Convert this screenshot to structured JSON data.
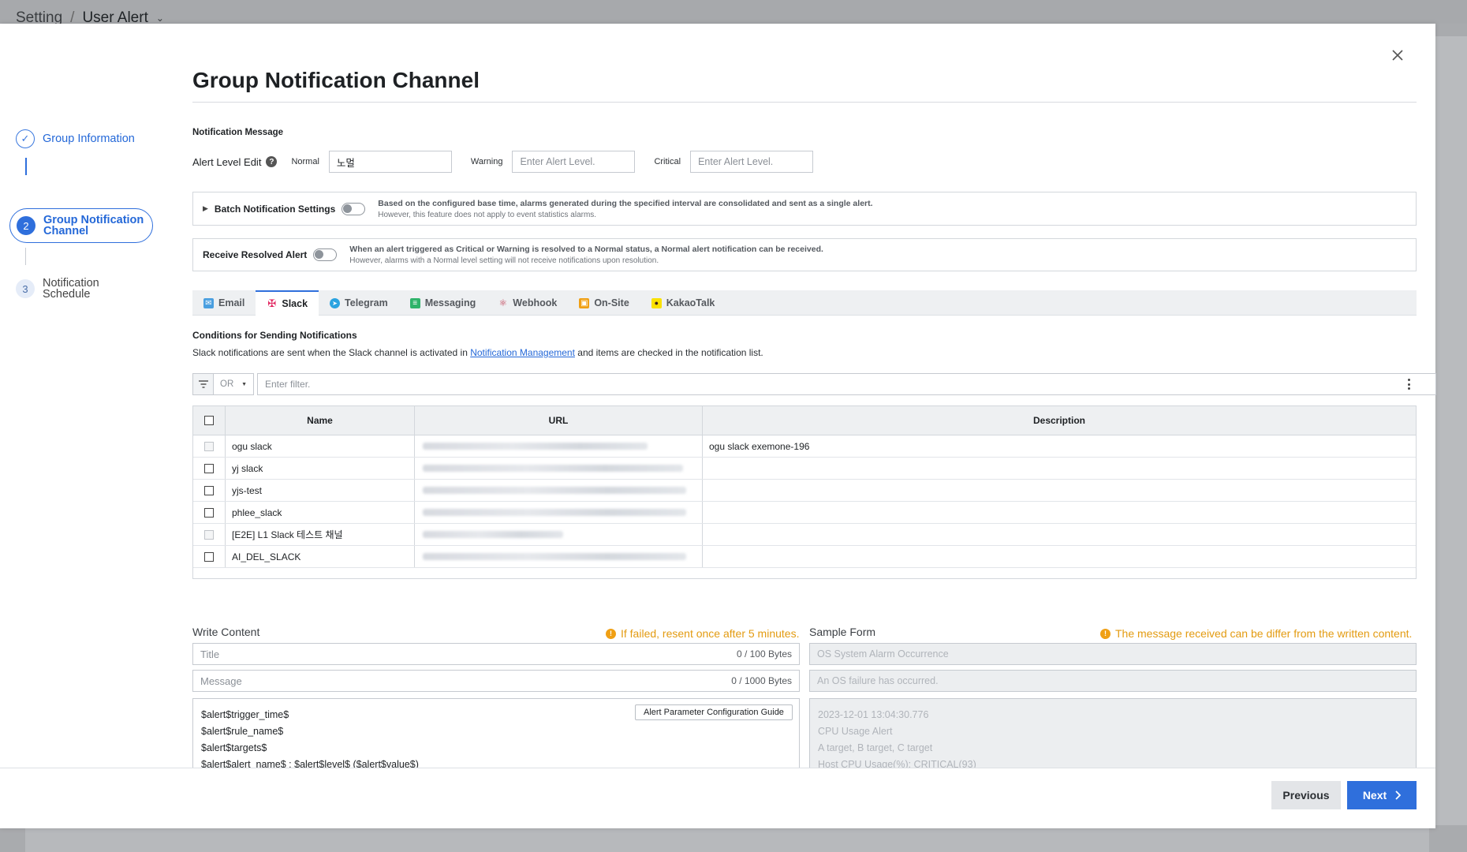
{
  "breadcrumb": {
    "root": "Setting",
    "separator": "/",
    "current": "User Alert"
  },
  "stepper": {
    "step1": {
      "label": "Group Information"
    },
    "step2": {
      "number": "2",
      "label_line1": "Group Notification",
      "label_line2": "Channel"
    },
    "step3": {
      "number": "3",
      "label_line1": "Notification",
      "label_line2": "Schedule"
    }
  },
  "modal": {
    "title": "Group Notification Channel"
  },
  "notification_message": {
    "section_label": "Notification Message",
    "alert_level_edit": "Alert Level Edit",
    "help": "?",
    "normal_label": "Normal",
    "normal_value": "노멀",
    "warning_label": "Warning",
    "warning_placeholder": "Enter Alert Level.",
    "critical_label": "Critical",
    "critical_placeholder": "Enter Alert Level."
  },
  "batch": {
    "label": "Batch Notification Settings",
    "desc1": "Based on the configured base time, alarms generated during the specified interval are consolidated and sent as a single alert.",
    "desc2": "However, this feature does not apply to event statistics alarms."
  },
  "resolved": {
    "label": "Receive Resolved Alert",
    "desc1": "When an alert triggered as Critical or Warning is resolved to a Normal status, a Normal alert notification can be received.",
    "desc2": "However, alarms with a Normal level setting will not receive notifications upon resolution."
  },
  "tabs": [
    {
      "label": "Email"
    },
    {
      "label": "Slack"
    },
    {
      "label": "Telegram"
    },
    {
      "label": "Messaging"
    },
    {
      "label": "Webhook"
    },
    {
      "label": "On-Site"
    },
    {
      "label": "KakaoTalk"
    }
  ],
  "conditions": {
    "title": "Conditions for Sending Notifications",
    "desc_before": "Slack notifications are sent when the Slack channel is activated in ",
    "link": "Notification Management",
    "desc_after": " and items are checked in the notification list."
  },
  "filter": {
    "operator": "OR",
    "placeholder": "Enter filter."
  },
  "table": {
    "headers": {
      "name": "Name",
      "url": "URL",
      "description": "Description"
    },
    "rows": [
      {
        "name": "ogu slack",
        "description": "ogu slack exemone-196"
      },
      {
        "name": "yj slack",
        "description": ""
      },
      {
        "name": "yjs-test",
        "description": ""
      },
      {
        "name": "phlee_slack",
        "description": ""
      },
      {
        "name": "[E2E] L1 Slack 테스트 채널",
        "description": ""
      },
      {
        "name": "AI_DEL_SLACK",
        "description": ""
      }
    ]
  },
  "write_content": {
    "label": "Write Content",
    "warning": "If failed, resent once after 5 minutes.",
    "title_placeholder": "Title",
    "title_count": "0 / 100 Bytes",
    "message_placeholder": "Message",
    "message_count": "0 / 1000 Bytes",
    "guide_button": "Alert Parameter Configuration Guide",
    "body_lines": [
      "$alert$trigger_time$",
      "$alert$rule_name$",
      "$alert$targets$",
      "$alert$alert_name$ : $alert$level$ ($alert$value$)"
    ]
  },
  "sample_form": {
    "label": "Sample Form",
    "warning": "The message received can be differ from the written content.",
    "title": "OS System Alarm Occurrence",
    "message": "An OS failure has occurred.",
    "body_lines": [
      "2023-12-01 13:04:30.776",
      "CPU Usage Alert",
      "A target, B target, C target",
      "Host CPU Usage(%): CRITICAL(93)"
    ]
  },
  "footer": {
    "previous": "Previous",
    "next": "Next"
  },
  "colors": {
    "accent": "#2f6fdc",
    "warning": "#e39b11"
  }
}
